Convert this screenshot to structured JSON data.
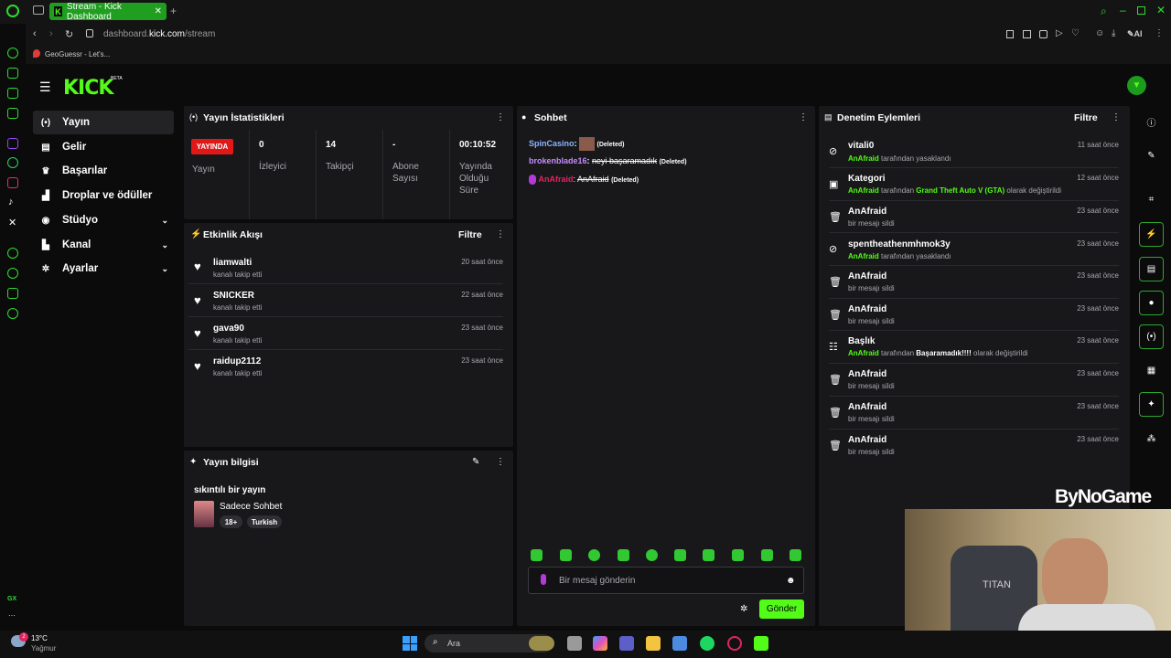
{
  "browser": {
    "tab_title": "Stream - Kick Dashboard",
    "url_prefix": "dashboard.",
    "url_domain": "kick.com",
    "url_path": "/stream",
    "bookmark": "GeoGuessr - Let's...",
    "ai_label": "AI"
  },
  "brand": {
    "logo": "KICK",
    "badge": "BETA",
    "accent": "#53fc18"
  },
  "nav": [
    {
      "label": "Yayın",
      "icon": "broadcast-icon"
    },
    {
      "label": "Gelir",
      "icon": "revenue-icon"
    },
    {
      "label": "Başarılar",
      "icon": "trophy-icon"
    },
    {
      "label": "Droplar ve ödüller",
      "icon": "drops-icon"
    },
    {
      "label": "Stüdyo",
      "icon": "studio-icon"
    },
    {
      "label": "Kanal",
      "icon": "channel-icon"
    },
    {
      "label": "Ayarlar",
      "icon": "settings-icon"
    }
  ],
  "stats": {
    "title": "Yayın İstatistikleri",
    "live_badge": "YAYINDA",
    "live_label": "Yayın",
    "items": [
      {
        "value": "0",
        "label": "İzleyici"
      },
      {
        "value": "14",
        "label": "Takipçi"
      },
      {
        "value": "-",
        "label": "Abone Sayısı"
      },
      {
        "value": "00:10:52",
        "label": "Yayında Olduğu Süre"
      }
    ]
  },
  "activity": {
    "title": "Etkinlik Akışı",
    "filter": "Filtre",
    "items": [
      {
        "name": "liamwalti",
        "sub": "kanalı takip etti",
        "time": "20 saat önce"
      },
      {
        "name": "SNICKER",
        "sub": "kanalı takip etti",
        "time": "22 saat önce"
      },
      {
        "name": "gava90",
        "sub": "kanalı takip etti",
        "time": "23 saat önce"
      },
      {
        "name": "raidup2112",
        "sub": "kanalı takip etti",
        "time": "23 saat önce"
      }
    ]
  },
  "info": {
    "title": "Yayın bilgisi",
    "stream_title": "sıkıntılı bir yayın",
    "category": "Sadece Sohbet",
    "tags": [
      "18+",
      "Turkish"
    ]
  },
  "chat": {
    "title": "Sohbet",
    "messages": [
      {
        "user": "SpinCasino",
        "text": "",
        "deleted": "(Deleted)",
        "color": "#8ab4ff"
      },
      {
        "user": "brokenblade16",
        "text": "neyi başaramadık",
        "deleted": "(Deleted)",
        "color": "#c58bff"
      },
      {
        "user": "AnAfraid",
        "text": "AnAfraid",
        "deleted": "(Deleted)",
        "color": "#e0245e"
      }
    ],
    "placeholder": "Bir mesaj gönderin",
    "send": "Gönder"
  },
  "moderation": {
    "title": "Denetim Eylemleri",
    "filter": "Filtre",
    "items": [
      {
        "icon": "ban-icon",
        "name": "vitali0",
        "actor": "AnAfraid",
        "text": "tarafından yasaklandı",
        "time": "11 saat önce"
      },
      {
        "icon": "category-icon",
        "name": "Kategori",
        "actor": "AnAfraid",
        "text": "tarafından",
        "value": "Grand Theft Auto V (GTA)",
        "tail": "olarak değiştirildi",
        "time": "12 saat önce"
      },
      {
        "icon": "trash-icon",
        "name": "AnAfraid",
        "text": "bir mesajı sildi",
        "time": "23 saat önce"
      },
      {
        "icon": "ban-icon",
        "name": "spentheathenmhmok3y",
        "actor": "AnAfraid",
        "text": "tarafından yasaklandı",
        "time": "23 saat önce"
      },
      {
        "icon": "trash-icon",
        "name": "AnAfraid",
        "text": "bir mesajı sildi",
        "time": "23 saat önce"
      },
      {
        "icon": "trash-icon",
        "name": "AnAfraid",
        "text": "bir mesajı sildi",
        "time": "23 saat önce"
      },
      {
        "icon": "title-icon",
        "name": "Başlık",
        "actor": "AnAfraid",
        "text": "tarafından",
        "value": "Başaramadık!!!!",
        "tail": "olarak değiştirildi",
        "time": "23 saat önce"
      },
      {
        "icon": "trash-icon",
        "name": "AnAfraid",
        "text": "bir mesajı sildi",
        "time": "23 saat önce"
      },
      {
        "icon": "trash-icon",
        "name": "AnAfraid",
        "text": "bir mesajı sildi",
        "time": "23 saat önce"
      },
      {
        "icon": "trash-icon",
        "name": "AnAfraid",
        "text": "bir mesajı sildi",
        "time": "23 saat önce"
      }
    ]
  },
  "overlay": {
    "watermark": "ByNoGame",
    "webcam_text": "TITAN"
  },
  "taskbar": {
    "temp": "13°C",
    "weather": "Yağmur",
    "search": "Ara",
    "notif_count": "2",
    "gx": "GX"
  }
}
